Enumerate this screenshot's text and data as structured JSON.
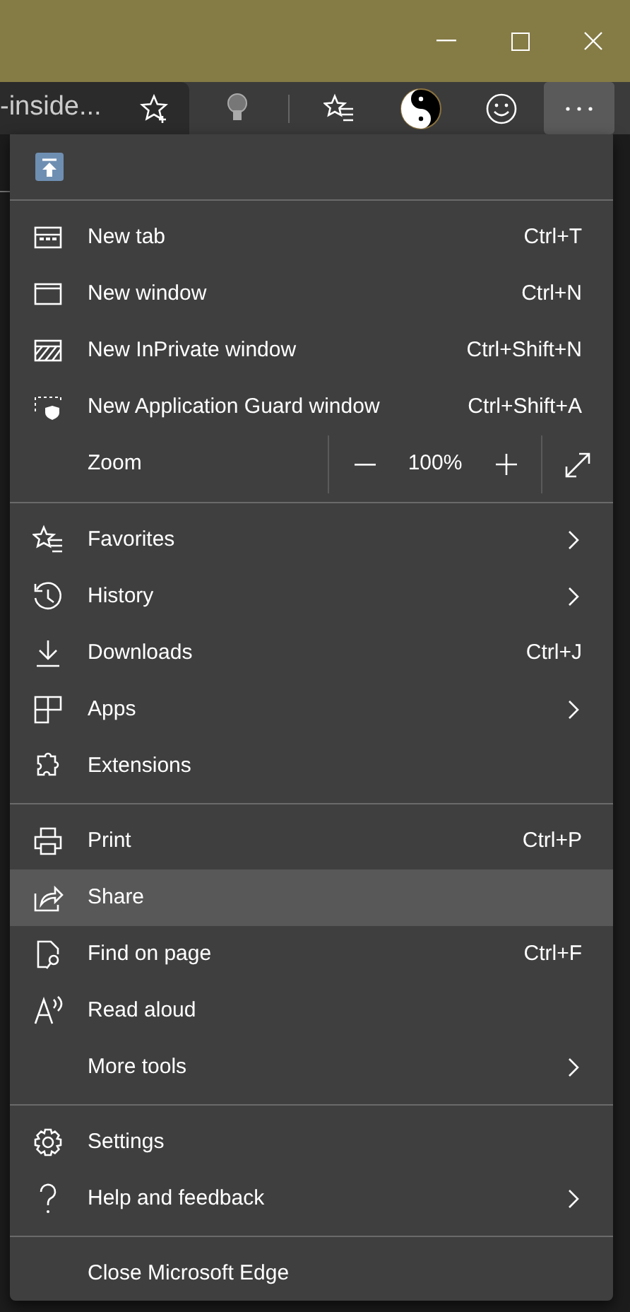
{
  "address_bar": {
    "text": "-inside..."
  },
  "toolbar": {
    "more_selected": true
  },
  "menu": {
    "sections": [
      {
        "items": [
          {
            "kind": "header"
          }
        ]
      },
      {
        "items": [
          {
            "kind": "command",
            "label": "New tab",
            "shortcut": "Ctrl+T",
            "submenu": false,
            "selected": false
          },
          {
            "kind": "command",
            "label": "New window",
            "shortcut": "Ctrl+N",
            "submenu": false,
            "selected": false
          },
          {
            "kind": "command",
            "label": "New InPrivate window",
            "shortcut": "Ctrl+Shift+N",
            "submenu": false,
            "selected": false
          },
          {
            "kind": "command",
            "label": "New Application Guard window",
            "shortcut": "Ctrl+Shift+A",
            "submenu": false,
            "selected": false
          },
          {
            "kind": "zoom",
            "label": "Zoom",
            "value": "100%"
          }
        ]
      },
      {
        "items": [
          {
            "kind": "command",
            "label": "Favorites",
            "submenu": true,
            "selected": false
          },
          {
            "kind": "command",
            "label": "History",
            "submenu": true,
            "selected": false
          },
          {
            "kind": "command",
            "label": "Downloads",
            "shortcut": "Ctrl+J",
            "submenu": false,
            "selected": false
          },
          {
            "kind": "command",
            "label": "Apps",
            "submenu": true,
            "selected": false
          },
          {
            "kind": "command",
            "label": "Extensions",
            "submenu": false,
            "selected": false
          }
        ]
      },
      {
        "items": [
          {
            "kind": "command",
            "label": "Print",
            "shortcut": "Ctrl+P",
            "submenu": false,
            "selected": false
          },
          {
            "kind": "command",
            "label": "Share",
            "submenu": false,
            "selected": true
          },
          {
            "kind": "command",
            "label": "Find on page",
            "shortcut": "Ctrl+F",
            "submenu": false,
            "selected": false
          },
          {
            "kind": "command",
            "label": "Read aloud",
            "submenu": false,
            "selected": false
          },
          {
            "kind": "command",
            "label": "More tools",
            "submenu": true,
            "selected": false
          }
        ]
      },
      {
        "items": [
          {
            "kind": "command",
            "label": "Settings",
            "submenu": false,
            "selected": false
          },
          {
            "kind": "command",
            "label": "Help and feedback",
            "submenu": true,
            "selected": false
          }
        ]
      },
      {
        "items": [
          {
            "kind": "command",
            "label": "Close Microsoft Edge",
            "submenu": false,
            "selected": false
          }
        ]
      }
    ]
  }
}
